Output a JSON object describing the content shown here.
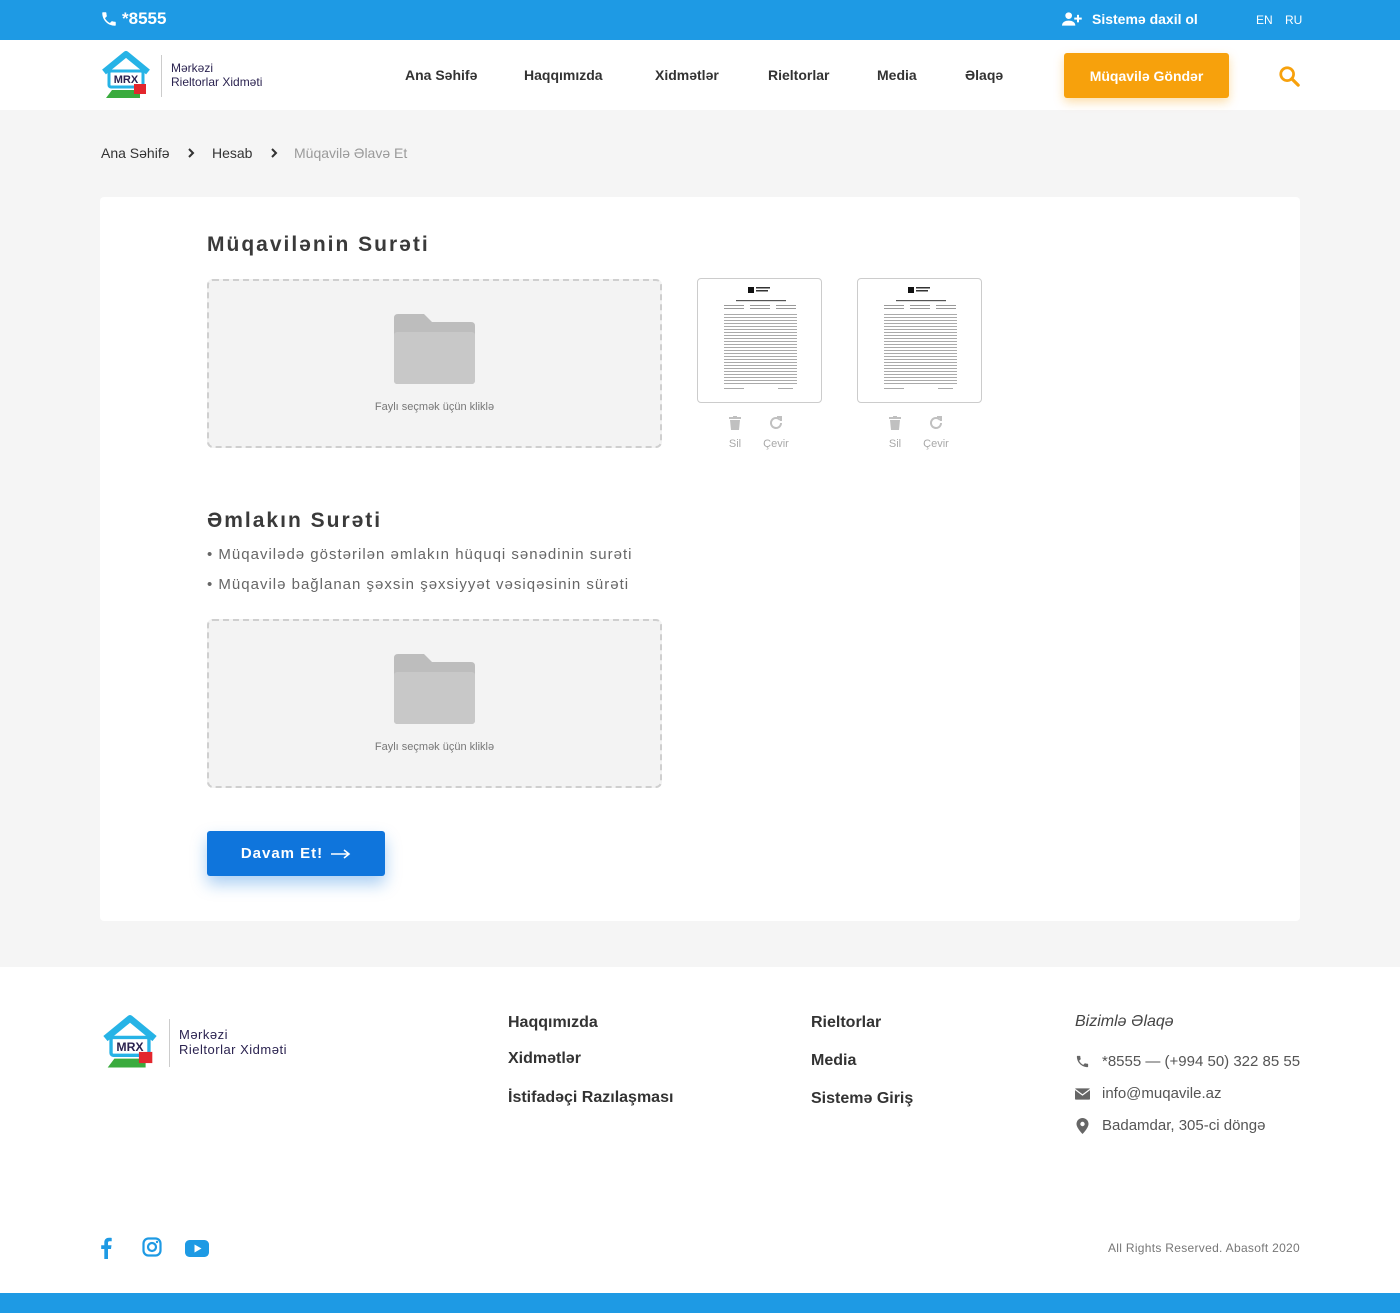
{
  "topbar": {
    "phone": "*8555",
    "login_label": "Sistemə daxil ol",
    "lang_en": "EN",
    "lang_ru": "RU"
  },
  "brand": {
    "mark": "MRX",
    "line1": "Mərkəzi",
    "line2": "Rieltorlar Xidməti"
  },
  "nav": {
    "home": "Ana Səhifə",
    "about": "Haqqımızda",
    "services": "Xidmətlər",
    "realtors": "Rieltorlar",
    "media": "Media",
    "contact": "Əlaqə",
    "cta": "Müqavilə Göndər"
  },
  "breadcrumb": {
    "home": "Ana Səhifə",
    "account": "Hesab",
    "current": "Müqavilə Əlavə Et"
  },
  "section1": {
    "title": "Müqavilənin Surəti",
    "drop_hint": "Faylı seçmək üçün kliklə",
    "delete": "Sil",
    "rotate": "Çevir"
  },
  "section2": {
    "title": "Əmlakın Surəti",
    "bullet1": "• Müqavilədə göstərilən əmlakın hüquqi sənədinin surəti",
    "bullet2": "• Müqavilə bağlanan şəxsin şəxsiyyət vəsiqəsinin sürəti",
    "drop_hint": "Faylı seçmək üçün kliklə"
  },
  "continue_label": "Davam Et!",
  "footer": {
    "about": "Haqqımızda",
    "services": "Xidmətlər",
    "agreement": "İstifadəçi Razılaşması",
    "realtors": "Rieltorlar",
    "media": "Media",
    "login": "Sistemə Giriş",
    "contact_title": "Bizimlə Əlaqə",
    "phone": "*8555 — (+994 50) 322 85 55",
    "email": "info@muqavile.az",
    "address": "Badamdar, 305-ci döngə",
    "copyright": "All Rights Reserved. Abasoft 2020"
  },
  "colors": {
    "primary_blue": "#1e9ae4",
    "cta_orange": "#f7a10c",
    "button_blue": "#0f75dc"
  }
}
